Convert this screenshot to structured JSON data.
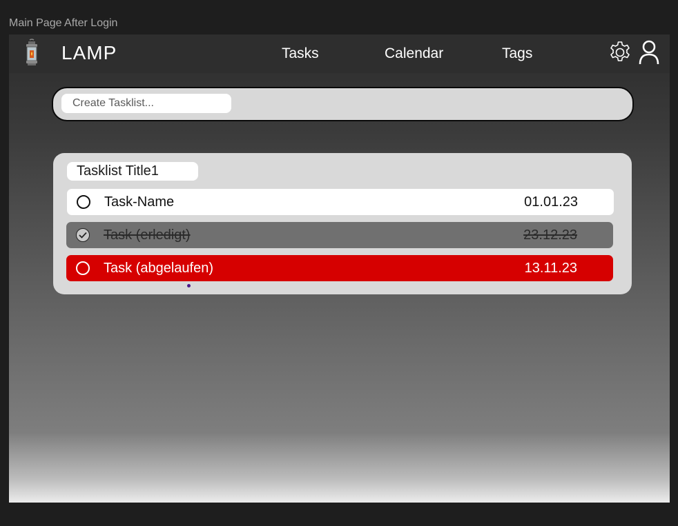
{
  "frame_label": "Main Page After Login",
  "navbar": {
    "brand": "LAMP",
    "links": [
      "Tasks",
      "Calendar",
      "Tags"
    ]
  },
  "icons": {
    "logo": "lantern-icon",
    "settings": "gear-icon",
    "user": "user-icon"
  },
  "create": {
    "placeholder": "Create Tasklist..."
  },
  "tasklist": {
    "title": "Tasklist Title1",
    "tasks": [
      {
        "name": "Task-Name",
        "date": "01.01.23",
        "state": "open"
      },
      {
        "name": "Task (erledigt)",
        "date": "23.12.23",
        "state": "done"
      },
      {
        "name": "Task (abgelaufen)",
        "date": "13.11.23",
        "state": "overdue"
      }
    ]
  },
  "colors": {
    "overdue": "#d60000",
    "done": "#707070",
    "navbar": "#2e2e2e"
  }
}
